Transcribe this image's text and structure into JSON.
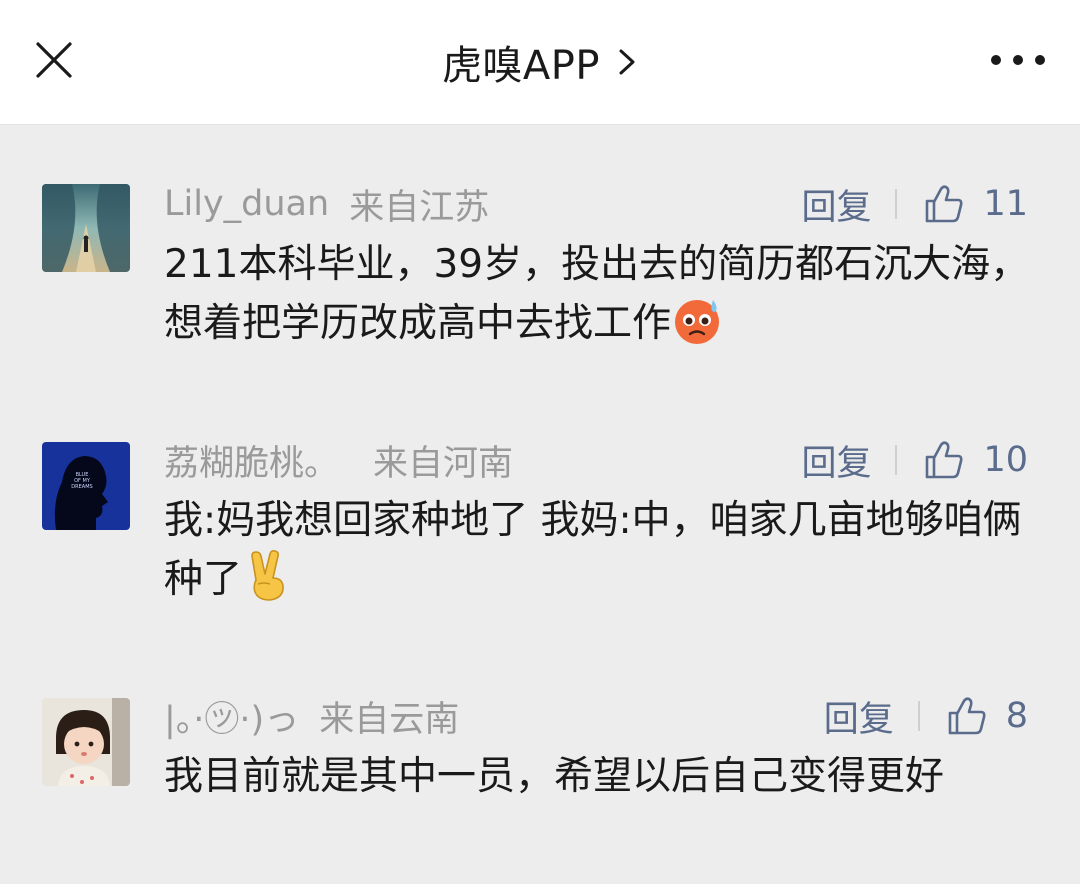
{
  "header": {
    "title": "虎嗅APP",
    "close_icon": "close-icon",
    "chevron_icon": "chevron-right-icon",
    "more_icon": "more-dots-icon"
  },
  "comments": [
    {
      "username": "Lily_duan",
      "location": "来自江苏",
      "reply_label": "回复",
      "likes": "11",
      "text": "211本科毕业，39岁，投出去的简历都石沉大海，想着把学历改成高中去找工作",
      "emoji": "anxious-sweat-face-emoji"
    },
    {
      "username": "荔糊脆桃。",
      "location": "来自河南",
      "reply_label": "回复",
      "likes": "10",
      "text": "我:妈我想回家种地了  我妈:中，咱家几亩地够咱俩种了",
      "emoji": "victory-hand-emoji"
    },
    {
      "username": "|。·㋡·)っ",
      "location": "来自云南",
      "reply_label": "回复",
      "likes": "8",
      "text": "我目前就是其中一员，希望以后自己变得更好",
      "emoji": ""
    }
  ],
  "colors": {
    "background": "#ededed",
    "topbar": "#ffffff",
    "meta_gray": "#9a9a9a",
    "action_blue": "#5a6b8c"
  }
}
